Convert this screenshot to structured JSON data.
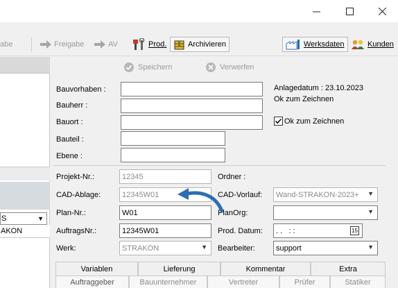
{
  "window": {
    "minimize": "—",
    "maximize": "☐",
    "close": "✕"
  },
  "toolbar": {
    "partial": "abe",
    "freigabe": "Freigabe",
    "av": "AV",
    "prod": "Prod.",
    "archivieren": "Archivieren",
    "werksdaten": "Werksdaten",
    "kunden": "Kunden"
  },
  "actions": {
    "speichern": "Speichern",
    "verwerfen": "Verwerfen"
  },
  "leftpanel": {
    "combo_value": "S",
    "row_value": "AKON"
  },
  "form": {
    "bauvorhaben_label": "Bauvorhaben :",
    "bauherr_label": "Bauherr :",
    "bauort_label": "Bauort :",
    "bauteil_label": "Bauteil :",
    "ebene_label": "Ebene :",
    "anlagedatum": "Anlagedatum : 23.10.2023",
    "ok_status": "Ok zum Zeichnen",
    "ok_checkbox_label": "Ok zum Zeichnen",
    "ok_checked": true,
    "projektnr_label": "Projekt-Nr.:",
    "projektnr_value": "12345",
    "ordner_label": "Ordner :",
    "cadablage_label": "CAD-Ablage:",
    "cadablage_value": "12345W01",
    "cadvorlauf_label": "CAD-Vorlauf:",
    "cadvorlauf_value": "Wand-STRAKON-2023+",
    "plannr_label": "Plan-Nr.:",
    "plannr_value": "W01",
    "planorg_label": "PlanOrg:",
    "planorg_value": "",
    "auftragsnr_label": "AuftragsNr.:",
    "auftragsnr_value": "12345W01",
    "proddatum_label": "Prod. Datum:",
    "proddatum_value": ". .   : :",
    "calendar_label": "15",
    "werk_label": "Werk:",
    "werk_value": "STRAKON",
    "bearbeiter_label": "Bearbeiter:",
    "bearbeiter_value": "support"
  },
  "tabs_row1": [
    "Variablen",
    "Lieferung",
    "Kommentar",
    "Extra"
  ],
  "tabs_row2": [
    "Auftraggeber",
    "Bauunternehmer",
    "Vertreter",
    "Prüfer",
    "Statiker"
  ],
  "colors": {
    "accent": "#2c6db5",
    "disabled": "#9a9a9a"
  }
}
